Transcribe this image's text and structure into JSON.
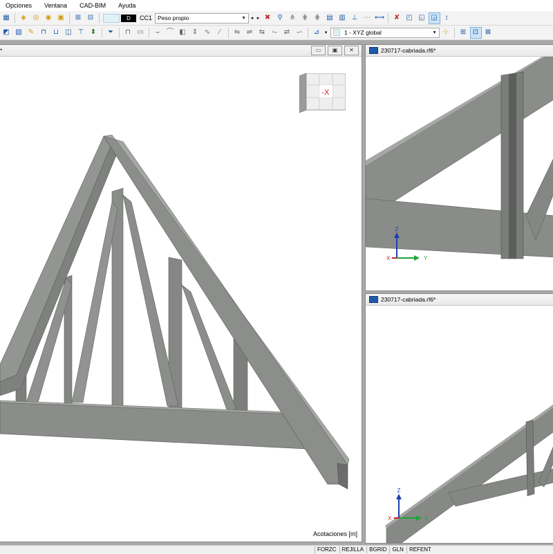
{
  "menu": [
    "Opciones",
    "Ventana",
    "CAD-BIM",
    "Ayuda"
  ],
  "toolbar": {
    "load_case_code": "D",
    "load_case_id": "CC1",
    "load_case_name": "Peso propio",
    "coord_system": "1 - XYZ global"
  },
  "icons": {
    "toolbar1": [
      "calc-icon",
      "node-icon",
      "member-icon",
      "solid-icon",
      "surface-icon",
      "zoom-icon",
      "dim-icon",
      "section-icon",
      "results-icon",
      "filter-icon",
      "render-icon",
      "view-icon",
      "iso-view-icon",
      "axis-icon"
    ],
    "toolbar2": [
      "display-icon",
      "layer-icon",
      "select-icon",
      "snap-icon",
      "grid-icon",
      "measure-icon",
      "load-icon",
      "support-icon",
      "line-icon",
      "arc-icon",
      "spline-icon",
      "coord-icon",
      "grid-toggle-icon",
      "wireframe-icon"
    ]
  },
  "windows": {
    "main": {
      "dimension_label": "Acotaciones [m]",
      "cube_label": "-X"
    },
    "top_right": {
      "title": "230717-cabriada.rf6",
      "modified": "*"
    },
    "bottom_right": {
      "title": "230717-cabriada.rf6",
      "modified": "*"
    },
    "axes": {
      "z": "Z",
      "y": "Y",
      "x": "X"
    }
  },
  "statusbar": [
    "FORZC",
    "REJILLA",
    "BGRID",
    "GLN",
    "REFENT"
  ],
  "colors": {
    "member": "#8b8d8a",
    "member_dark": "#5e605d",
    "member_light": "#a7a9a6",
    "accent": "#1f5aa8",
    "axis_z": "#1f3fb0",
    "axis_y": "#1fa33a",
    "axis_x": "#d02020"
  }
}
